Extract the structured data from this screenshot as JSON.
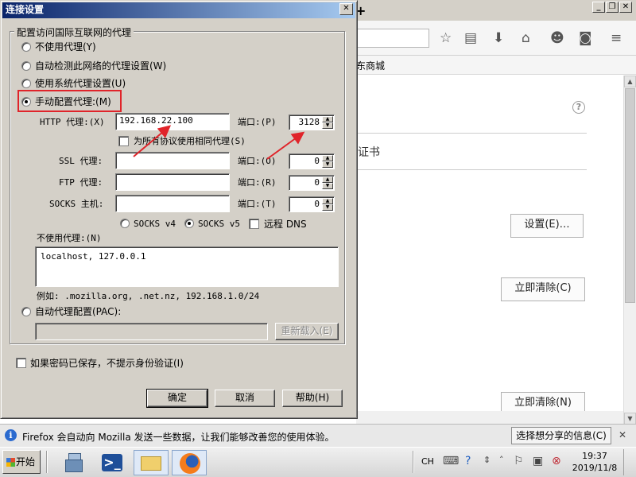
{
  "firefox": {
    "new_tab_symbol": "+",
    "bookmark_item": "东商城",
    "cert_text": "证书",
    "help_symbol": "?",
    "settings_button": "设置(E)…",
    "clear_button_1": "立即清除(C)",
    "clear_button_2": "立即清除(N)",
    "notification_text": "Firefox 会自动向 Mozilla 发送一些数据，让我们能够改善您的使用体验。",
    "notification_button": "选择想分享的信息(C)",
    "notification_close": "✕",
    "window_buttons": [
      "_",
      "❐",
      "✕"
    ]
  },
  "dialog": {
    "title": "连接设置",
    "close_symbol": "✕",
    "group_legend": "配置访问国际互联网的代理",
    "options": {
      "no_proxy": "不使用代理(Y)",
      "auto_detect": "自动检测此网络的代理设置(W)",
      "system_proxy": "使用系统代理设置(U)",
      "manual": "手动配置代理:(M)",
      "pac": "自动代理配置(PAC):"
    },
    "selected_option": "manual",
    "http": {
      "label": "HTTP 代理:(X)",
      "value": "192.168.22.100",
      "port_label": "端口:(P)",
      "port": "3128"
    },
    "same_proxy_label": "为所有协议使用相同代理(S)",
    "same_proxy_checked": false,
    "ssl": {
      "label": "SSL 代理:",
      "value": "",
      "port_label": "端口:(O)",
      "port": "0"
    },
    "ftp": {
      "label": "FTP 代理:",
      "value": "",
      "port_label": "端口:(R)",
      "port": "0"
    },
    "socks": {
      "label": "SOCKS 主机:",
      "value": "",
      "port_label": "端口:(T)",
      "port": "0"
    },
    "socks_v4": "SOCKS v4",
    "socks_v5": "SOCKS v5",
    "socks_version_selected": "v5",
    "remote_dns": "远程 DNS",
    "remote_dns_checked": false,
    "no_proxy_label": "不使用代理:(N)",
    "no_proxy_value": "localhost, 127.0.0.1",
    "example_text": "例如: .mozilla.org, .net.nz, 192.168.1.0/24",
    "pac_value": "",
    "reload_button": "重新载入(E)",
    "no_prompt_label": "如果密码已保存，不提示身份验证(I)",
    "no_prompt_checked": false,
    "ok_button": "确定",
    "cancel_button": "取消",
    "help_button": "帮助(H)",
    "highlight_color": "#e0242a"
  },
  "taskbar": {
    "start_label": "开始",
    "lang": "CH",
    "time": "19:37",
    "date": "2019/11/8"
  }
}
